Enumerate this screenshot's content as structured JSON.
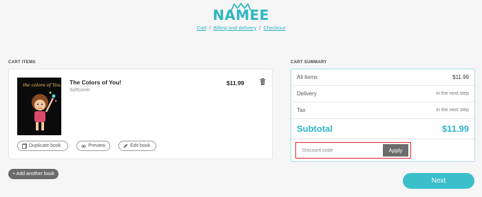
{
  "header": {
    "logo_text": "NAMEE",
    "breadcrumb": [
      {
        "label": "Cart"
      },
      {
        "label": "Billing and delivery"
      },
      {
        "label": "Checkout"
      }
    ],
    "separator": "/"
  },
  "cart": {
    "section_label": "CART ITEMS",
    "item": {
      "cover_text": "the colors of You!",
      "title": "The Colors of You!",
      "format": "Softcover",
      "price": "$11.99",
      "actions": {
        "duplicate": "Duplicate book",
        "preview": "Preview",
        "edit": "Edit book"
      }
    },
    "add_another": "+ Add another book"
  },
  "summary": {
    "section_label": "CART SUMMARY",
    "rows": [
      {
        "label": "All items",
        "value": "$11.99"
      },
      {
        "label": "Delivery",
        "value": "in the next step"
      },
      {
        "label": "Tax",
        "value": "in the next step"
      }
    ],
    "subtotal": {
      "label": "Subtotal",
      "value": "$11.99"
    },
    "discount": {
      "placeholder": "Discount code",
      "value": "",
      "apply_label": "Apply"
    }
  },
  "next_label": "Next",
  "colors": {
    "brand": "#2fb5c3",
    "highlight": "#e02020",
    "button_gray": "#6b6b6b"
  }
}
